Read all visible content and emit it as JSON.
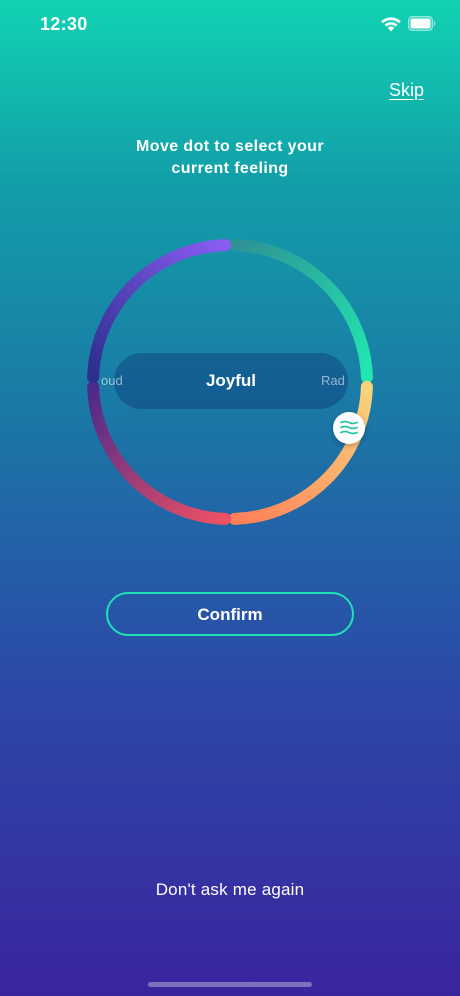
{
  "status_bar": {
    "time": "12:30"
  },
  "header": {
    "skip_label": "Skip"
  },
  "prompt": {
    "instruction_line1": "Move dot to select your",
    "instruction_line2": "current feeling"
  },
  "mood_wheel": {
    "current_feeling": "Joyful",
    "previous_feeling_partial": "oud",
    "next_feeling_partial": "Rad",
    "dot_icon": "waves-icon",
    "colors": {
      "purple": "#7a4cf0",
      "teal": "#22e6b0",
      "yellow": "#f8d37a",
      "orange": "#ff8e5e",
      "red": "#e8405c",
      "indigo": "#3a2da8"
    }
  },
  "actions": {
    "confirm_label": "Confirm",
    "dont_ask_label": "Don't ask me again"
  },
  "theme": {
    "accent": "#1fe0b6",
    "background_top": "#11d3b3",
    "background_bottom": "#3a249f"
  }
}
